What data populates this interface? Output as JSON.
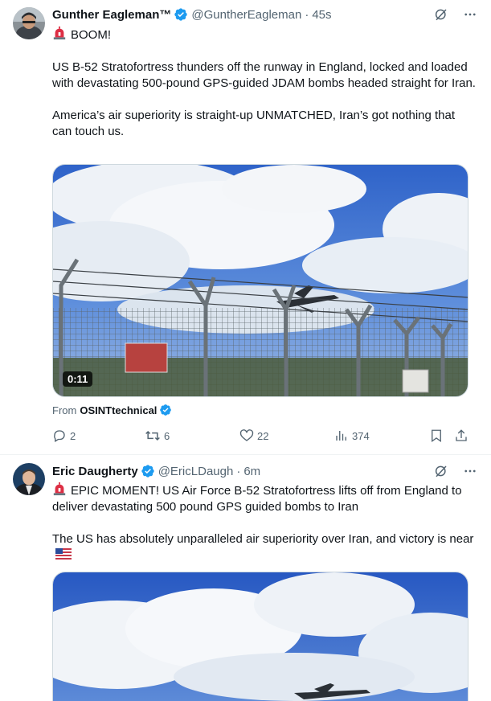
{
  "tweets": [
    {
      "author_name": "Gunther Eagleman™",
      "handle": "@GuntherEagleman",
      "time": "45s",
      "text_line1": "BOOM!",
      "text_para2": "US B-52 Stratofortress thunders off the runway in England, locked and loaded with devastating 500-pound GPS-guided JDAM bombs headed straight for Iran.",
      "text_para3": "America’s air superiority is straight-up UNMATCHED, Iran’s got nothing that can touch us.",
      "video_duration": "0:11",
      "from_label": "From",
      "from_source": "OSINTtechnical",
      "replies": "2",
      "reposts": "6",
      "likes": "22",
      "views": "374"
    },
    {
      "author_name": "Eric Daugherty",
      "handle": "@EricLDaugh",
      "time": "6m",
      "text_para1": "EPIC MOMENT! US Air Force B-52 Stratofortress lifts off from England to deliver devastating 500 pound GPS guided bombs to Iran",
      "text_para2": "The US has absolutely unparalleled air superiority over Iran, and victory is near"
    }
  ],
  "colors": {
    "accent": "#1d9bf0",
    "secondary_text": "#536471",
    "alarm": "#e0245e"
  },
  "icons": [
    "verified-badge-icon",
    "grok-icon",
    "more-icon",
    "reply-icon",
    "repost-icon",
    "like-icon",
    "views-icon",
    "bookmark-icon",
    "share-icon",
    "siren-emoji-icon",
    "us-flag-emoji-icon"
  ]
}
